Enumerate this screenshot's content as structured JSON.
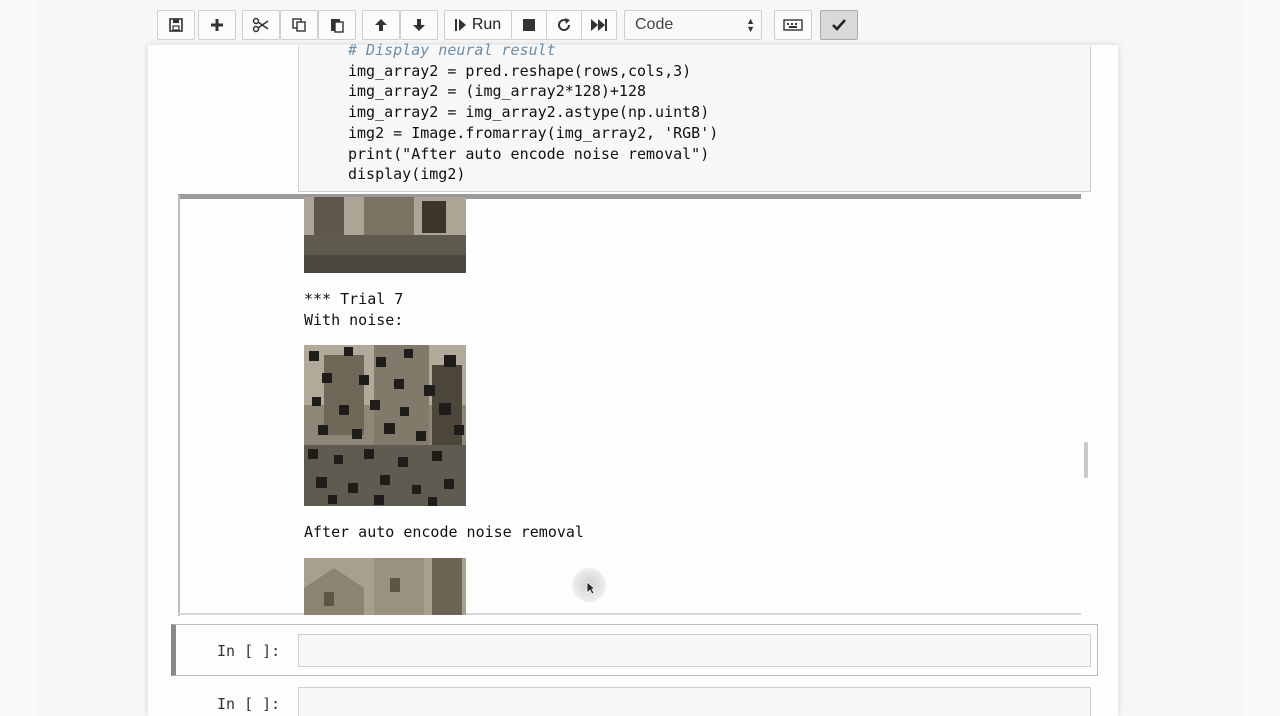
{
  "toolbar": {
    "run_label": "Run",
    "cell_type": "Code",
    "icons": [
      "save-icon",
      "plus-icon",
      "cut-icon",
      "copy-icon",
      "paste-icon",
      "arrow-up-icon",
      "arrow-down-icon",
      "run-icon",
      "stop-icon",
      "restart-icon",
      "fast-forward-icon",
      "keyboard-icon",
      "check-icon"
    ]
  },
  "code_cell": {
    "lines": [
      "# Display neural result",
      "img_array2 = pred.reshape(rows,cols,3)",
      "img_array2 = (img_array2*128)+128",
      "img_array2 = img_array2.astype(np.uint8)",
      "img2 = Image.fromarray(img_array2, 'RGB')",
      "print(\"After auto encode noise removal\")",
      "display(img2)"
    ]
  },
  "output": {
    "trial_label": "*** Trial 7",
    "with_noise_label": "With noise:",
    "after_label": "After auto encode noise removal"
  },
  "cells": {
    "prompt_1": "In [ ]:",
    "prompt_2": "In [ ]:"
  }
}
